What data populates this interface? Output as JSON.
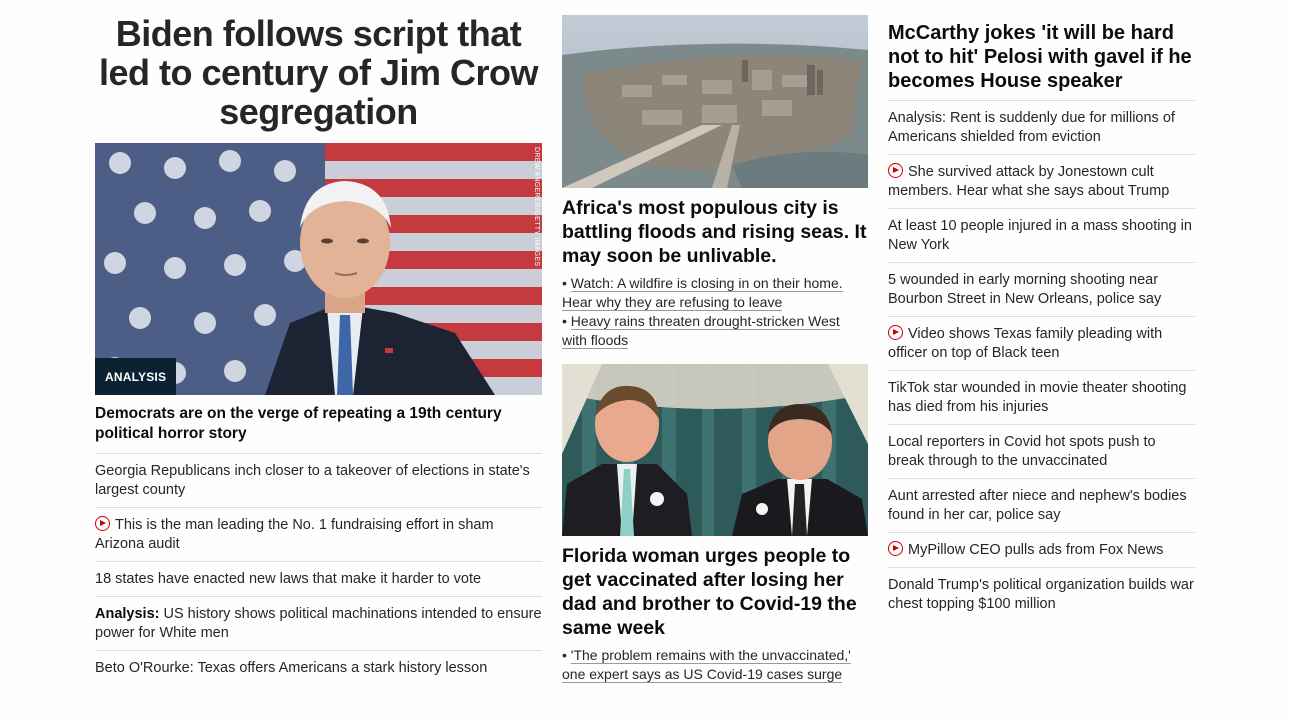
{
  "column1": {
    "hero_title": "Biden follows script that led to century of Jim Crow segregation",
    "image_badge": "ANALYSIS",
    "image_credit": "DREW ANGERER/GETTY IMAGES",
    "lead_headline": "Democrats are on the verge of repeating a 19th century political horror story",
    "items": [
      {
        "text": "Georgia Republicans inch closer to a takeover of elections in state's largest county",
        "video": false,
        "prefix": ""
      },
      {
        "text": "This is the man leading the No. 1 fundraising effort in sham Arizona audit",
        "video": true,
        "prefix": ""
      },
      {
        "text": "18 states have enacted new laws that make it harder to vote",
        "video": false,
        "prefix": ""
      },
      {
        "text": "US history shows political machinations intended to ensure power for White men",
        "video": false,
        "prefix": "Analysis:"
      },
      {
        "text": "Beto O'Rourke: Texas offers Americans a stark history lesson",
        "video": false,
        "prefix": ""
      }
    ]
  },
  "column2": {
    "card1": {
      "title": "Africa's most populous city is battling floods and rising seas. It may soon be unlivable.",
      "links": [
        "Watch: A wildfire is closing in on their home. Hear why they are refusing to leave",
        "Heavy rains threaten drought-stricken West with floods"
      ]
    },
    "card2": {
      "title": "Florida woman urges people to get vaccinated after losing her dad and brother to Covid-19 the same week",
      "links": [
        "'The problem remains with the unvaccinated,' one expert says as US Covid-19 cases surge"
      ]
    },
    "bullet": "•"
  },
  "column3": {
    "headline": "McCarthy jokes 'it will be hard not to hit' Pelosi with gavel if he becomes House speaker",
    "items": [
      {
        "text": "Analysis: Rent is suddenly due for millions of Americans shielded from eviction",
        "video": false
      },
      {
        "text": "She survived attack by Jonestown cult members. Hear what she says about Trump",
        "video": true
      },
      {
        "text": "At least 10 people injured in a mass shooting in New York",
        "video": false
      },
      {
        "text": "5 wounded in early morning shooting near Bourbon Street in New Orleans, police say",
        "video": false
      },
      {
        "text": "Video shows Texas family pleading with officer on top of Black teen",
        "video": true
      },
      {
        "text": "TikTok star wounded in movie theater shooting has died from his injuries",
        "video": false
      },
      {
        "text": "Local reporters in Covid hot spots push to break through to the unvaccinated",
        "video": false
      },
      {
        "text": "Aunt arrested after niece and nephew's bodies found in her car, police say",
        "video": false
      },
      {
        "text": "MyPillow CEO pulls ads from Fox News",
        "video": true
      },
      {
        "text": "Donald Trump's political organization builds war chest topping $100 million",
        "video": false
      }
    ]
  },
  "colors": {
    "text": "#262626",
    "headline": "#0c0c0c",
    "video_red": "#cc0000",
    "badge_bg": "#0c2233",
    "divider": "#dedede"
  }
}
